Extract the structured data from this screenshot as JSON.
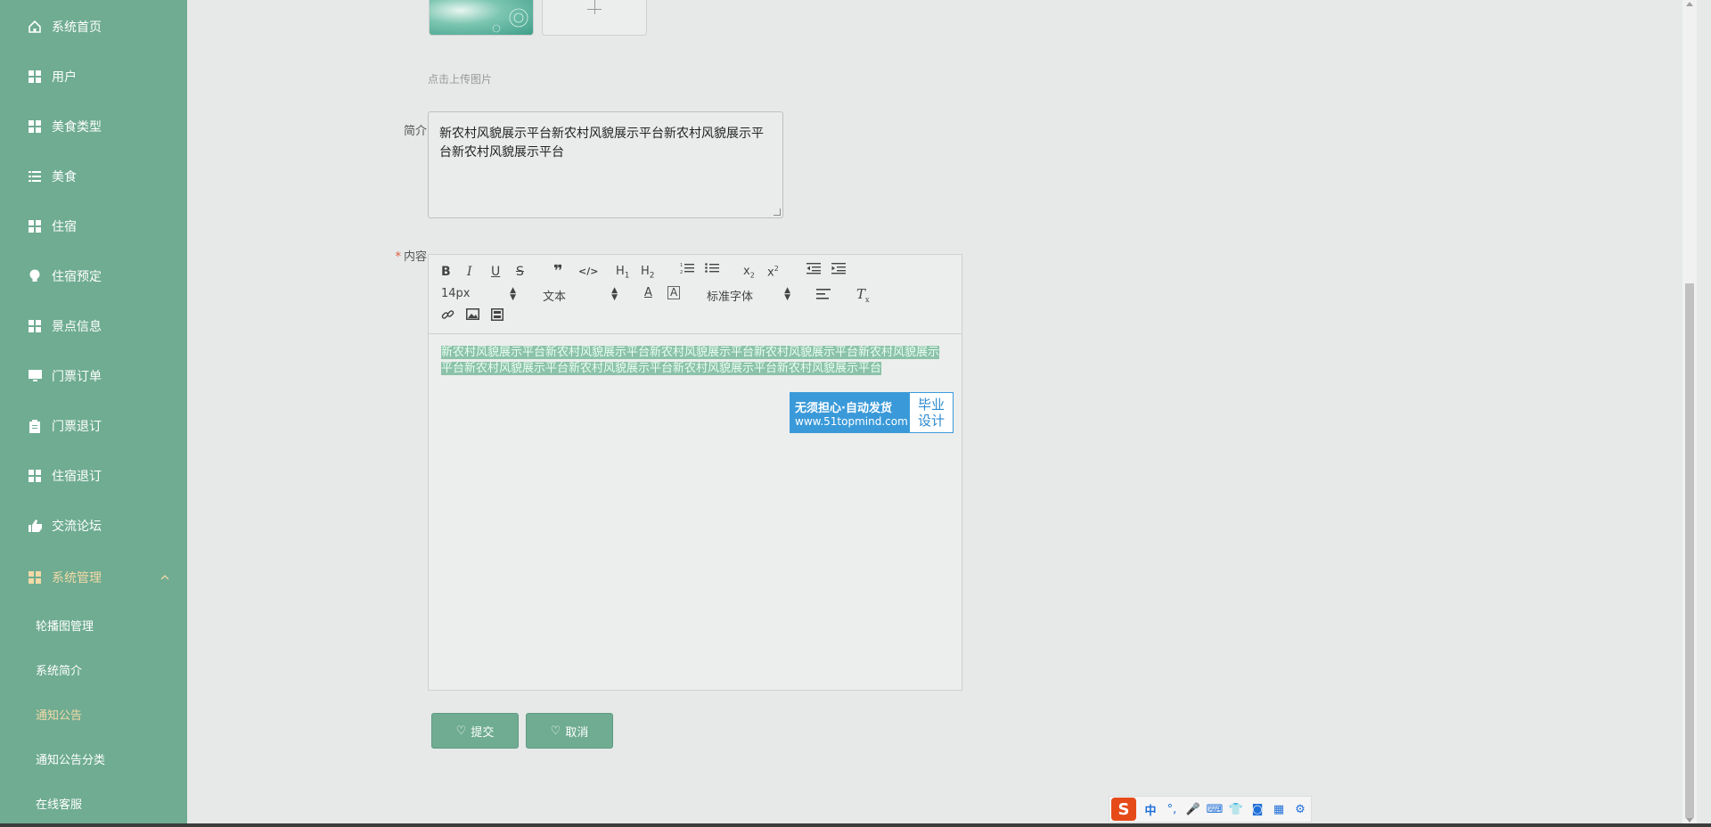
{
  "sidebar": {
    "items": [
      {
        "label": "系统首页",
        "icon": "home-icon"
      },
      {
        "label": "用户",
        "icon": "grid-icon"
      },
      {
        "label": "美食类型",
        "icon": "grid-icon"
      },
      {
        "label": "美食",
        "icon": "list-icon"
      },
      {
        "label": "住宿",
        "icon": "grid-icon"
      },
      {
        "label": "住宿预定",
        "icon": "bulb-icon"
      },
      {
        "label": "景点信息",
        "icon": "grid-icon"
      },
      {
        "label": "门票订单",
        "icon": "monitor-icon"
      },
      {
        "label": "门票退订",
        "icon": "clipboard-icon"
      },
      {
        "label": "住宿退订",
        "icon": "grid-icon"
      },
      {
        "label": "交流论坛",
        "icon": "thumb-icon"
      }
    ],
    "group": {
      "label": "系统管理",
      "icon": "grid-icon",
      "caret": "chevron-up-icon"
    },
    "subitems": [
      {
        "label": "轮播图管理"
      },
      {
        "label": "系统简介"
      },
      {
        "label": "通知公告",
        "active": true
      },
      {
        "label": "通知公告分类"
      },
      {
        "label": "在线客服"
      }
    ]
  },
  "form": {
    "upload_hint": "点击上传图片",
    "intro_label": "简介",
    "intro_value": "新农村风貌展示平台新农村风貌展示平台新农村风貌展示平台新农村风貌展示平台",
    "content_label": "内容",
    "content_required_mark": "*",
    "editor": {
      "font_size": "14px",
      "paragraph": "文本",
      "font_family": "标准字体",
      "content_line1": "新农村风貌展示平台新农村风貌展示平台新农村风貌展示平台新农村风貌展示平台新农村风貌展示",
      "content_line2": "平台新农村风貌展示平台新农村风貌展示平台新农村风貌展示平台新农村风貌展示平台"
    },
    "submit_label": "提交",
    "cancel_label": "取消"
  },
  "badge": {
    "line1": "无须担心·自动发货",
    "line2": "www.51topmind.com",
    "right1": "毕业",
    "right2": "设计"
  },
  "ime": {
    "logo": "S",
    "lang": "中",
    "punct": "°,"
  },
  "colors": {
    "sidebar_bg": "#6fac92",
    "active_text": "#f2d9a6",
    "button_bg": "#6fac92",
    "selection": "#8cc2a9"
  }
}
